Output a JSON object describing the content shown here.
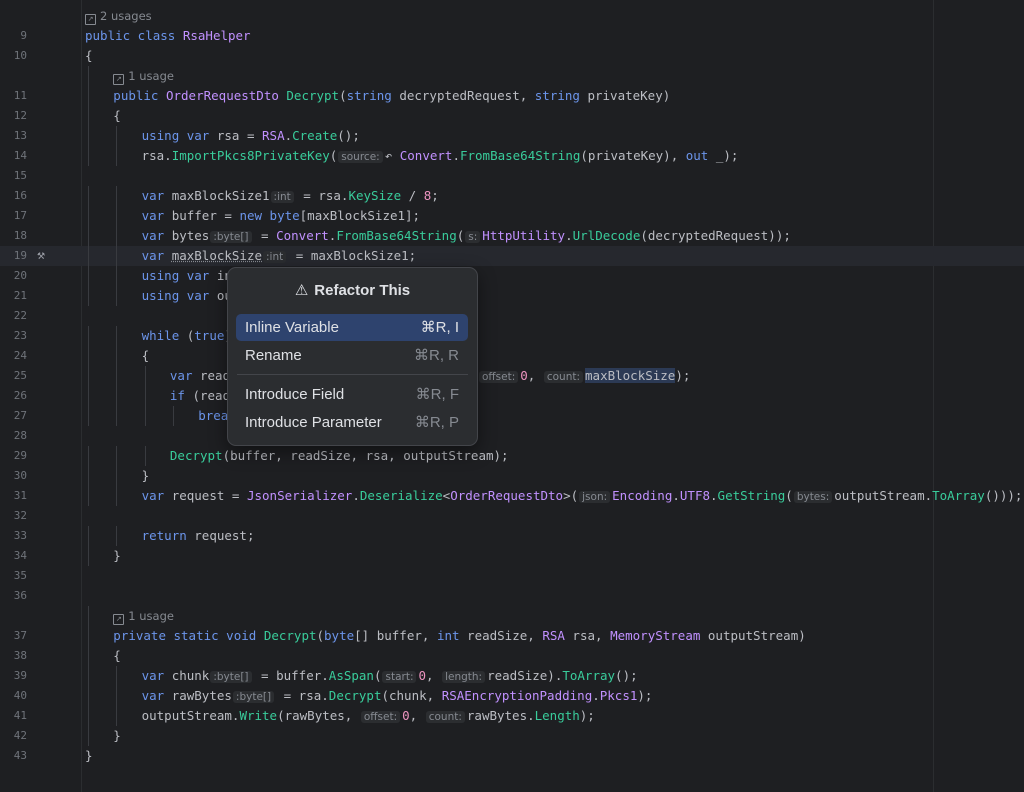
{
  "editor": {
    "lines": [
      {
        "ln": "",
        "tokens": [
          [
            "usage",
            "2 usages"
          ]
        ]
      },
      {
        "ln": "9",
        "tokens": [
          [
            "kw",
            "public class "
          ],
          [
            "ty",
            "RsaHelper"
          ]
        ]
      },
      {
        "ln": "10",
        "tokens": [
          [
            "sy",
            "{"
          ]
        ]
      },
      {
        "ln": "",
        "indent": 1,
        "tokens": [
          [
            "usage",
            "1 usage"
          ]
        ]
      },
      {
        "ln": "11",
        "indent": 1,
        "tokens": [
          [
            "kw",
            "public "
          ],
          [
            "ty",
            "OrderRequestDto "
          ],
          [
            "fn",
            "Decrypt"
          ],
          [
            "sy",
            "("
          ],
          [
            "kw",
            "string "
          ],
          [
            "sy",
            "decryptedRequest, "
          ],
          [
            "kw",
            "string "
          ],
          [
            "sy",
            "privateKey)"
          ]
        ]
      },
      {
        "ln": "12",
        "indent": 1,
        "tokens": [
          [
            "sy",
            "{"
          ]
        ]
      },
      {
        "ln": "13",
        "indent": 2,
        "tokens": [
          [
            "kw",
            "using var "
          ],
          [
            "sy",
            "rsa = "
          ],
          [
            "ty",
            "RSA"
          ],
          [
            "sy",
            "."
          ],
          [
            "fn",
            "Create"
          ],
          [
            "sy",
            "();"
          ]
        ]
      },
      {
        "ln": "14",
        "indent": 2,
        "tokens": [
          [
            "sy",
            "rsa."
          ],
          [
            "fn",
            "ImportPkcs8PrivateKey"
          ],
          [
            "sy",
            "("
          ],
          [
            "hint",
            "source:"
          ],
          [
            "sy",
            "↶ "
          ],
          [
            "ty",
            "Convert"
          ],
          [
            "sy",
            "."
          ],
          [
            "fn",
            "FromBase64String"
          ],
          [
            "sy",
            "(privateKey), "
          ],
          [
            "kw",
            "out "
          ],
          [
            "sy",
            "_);"
          ]
        ]
      },
      {
        "ln": "15",
        "tokens": []
      },
      {
        "ln": "16",
        "indent": 2,
        "tokens": [
          [
            "kw",
            "var "
          ],
          [
            "sy",
            "maxBlockSize1"
          ],
          [
            "hint",
            ":int"
          ],
          [
            "sy",
            " = rsa."
          ],
          [
            "fn",
            "KeySize"
          ],
          [
            "sy",
            " / "
          ],
          [
            "num",
            "8"
          ],
          [
            "sy",
            ";"
          ]
        ]
      },
      {
        "ln": "17",
        "indent": 2,
        "tokens": [
          [
            "kw",
            "var "
          ],
          [
            "sy",
            "buffer = "
          ],
          [
            "kw",
            "new byte"
          ],
          [
            "sy",
            "[maxBlockSize1];"
          ]
        ]
      },
      {
        "ln": "18",
        "indent": 2,
        "tokens": [
          [
            "kw",
            "var "
          ],
          [
            "sy",
            "bytes"
          ],
          [
            "hint",
            ":byte[]"
          ],
          [
            "sy",
            " = "
          ],
          [
            "ty",
            "Convert"
          ],
          [
            "sy",
            "."
          ],
          [
            "fn",
            "FromBase64String"
          ],
          [
            "sy",
            "("
          ],
          [
            "hint",
            "s:"
          ],
          [
            "ty",
            "HttpUtility"
          ],
          [
            "sy",
            "."
          ],
          [
            "fn",
            "UrlDecode"
          ],
          [
            "sy",
            "(decryptedRequest));"
          ]
        ]
      },
      {
        "ln": "19",
        "indent": 2,
        "gutterIcon": true,
        "caret": true,
        "tokens": [
          [
            "kw",
            "var "
          ],
          [
            "underline",
            "maxBlockSize"
          ],
          [
            "hint",
            ":int"
          ],
          [
            "sy",
            " = maxBlockSize1;"
          ]
        ]
      },
      {
        "ln": "20",
        "indent": 2,
        "tokens": [
          [
            "kw",
            "using var "
          ],
          [
            "sy",
            "in"
          ]
        ]
      },
      {
        "ln": "21",
        "indent": 2,
        "tokens": [
          [
            "kw",
            "using var "
          ],
          [
            "sy",
            "ou"
          ]
        ]
      },
      {
        "ln": "22",
        "tokens": []
      },
      {
        "ln": "23",
        "indent": 2,
        "tokens": [
          [
            "kw",
            "while "
          ],
          [
            "sy",
            "("
          ],
          [
            "kw",
            "true"
          ],
          [
            "sy",
            ")"
          ]
        ]
      },
      {
        "ln": "24",
        "indent": 2,
        "tokens": [
          [
            "sy",
            "{"
          ]
        ]
      },
      {
        "ln": "25",
        "indent": 3,
        "tokens": [
          [
            "kw",
            "var "
          ],
          [
            "sy",
            "read"
          ]
        ]
      },
      {
        "ln": "26",
        "indent": 3,
        "tokens": [
          [
            "kw",
            "if "
          ],
          [
            "sy",
            "(read"
          ]
        ]
      },
      {
        "ln": "27",
        "indent": 4,
        "tokens": [
          [
            "kw",
            "brea"
          ]
        ]
      },
      {
        "ln": "28",
        "tokens": []
      },
      {
        "ln": "29",
        "indent": 3,
        "tokens": [
          [
            "fn",
            "Decrypt"
          ],
          [
            "sy",
            "(buffer, readSize, rsa, outputStream);"
          ]
        ]
      },
      {
        "ln": "30",
        "indent": 2,
        "tokens": [
          [
            "sy",
            "}"
          ]
        ]
      },
      {
        "ln": "31",
        "indent": 2,
        "tokens": [
          [
            "kw",
            "var "
          ],
          [
            "sy",
            "request = "
          ],
          [
            "ty",
            "JsonSerializer"
          ],
          [
            "sy",
            "."
          ],
          [
            "fn",
            "Deserialize"
          ],
          [
            "sy",
            "<"
          ],
          [
            "ty",
            "OrderRequestDto"
          ],
          [
            "sy",
            ">("
          ],
          [
            "hint",
            "json:"
          ],
          [
            "ty",
            "Encoding"
          ],
          [
            "sy",
            "."
          ],
          [
            "ty",
            "UTF8"
          ],
          [
            "sy",
            "."
          ],
          [
            "fn",
            "GetString"
          ],
          [
            "sy",
            "("
          ],
          [
            "hint",
            "bytes:"
          ],
          [
            "sy",
            "outputStream."
          ],
          [
            "fn",
            "ToArray"
          ],
          [
            "sy",
            "()));"
          ]
        ]
      },
      {
        "ln": "32",
        "tokens": []
      },
      {
        "ln": "33",
        "indent": 2,
        "tokens": [
          [
            "kw",
            "return "
          ],
          [
            "sy",
            "request;"
          ]
        ]
      },
      {
        "ln": "34",
        "indent": 1,
        "tokens": [
          [
            "sy",
            "}"
          ]
        ]
      },
      {
        "ln": "35",
        "tokens": []
      },
      {
        "ln": "36",
        "tokens": []
      },
      {
        "ln": "",
        "indent": 1,
        "tokens": [
          [
            "usage",
            "1 usage"
          ]
        ]
      },
      {
        "ln": "37",
        "indent": 1,
        "tokens": [
          [
            "kw",
            "private static void "
          ],
          [
            "fn",
            "Decrypt"
          ],
          [
            "sy",
            "("
          ],
          [
            "kw",
            "byte"
          ],
          [
            "sy",
            "[] buffer, "
          ],
          [
            "kw",
            "int "
          ],
          [
            "sy",
            "readSize, "
          ],
          [
            "ty",
            "RSA "
          ],
          [
            "sy",
            "rsa, "
          ],
          [
            "ty",
            "MemoryStream "
          ],
          [
            "sy",
            "outputStream)"
          ]
        ]
      },
      {
        "ln": "38",
        "indent": 1,
        "tokens": [
          [
            "sy",
            "{"
          ]
        ]
      },
      {
        "ln": "39",
        "indent": 2,
        "tokens": [
          [
            "kw",
            "var "
          ],
          [
            "sy",
            "chunk"
          ],
          [
            "hint",
            ":byte[]"
          ],
          [
            "sy",
            " = buffer."
          ],
          [
            "fn",
            "AsSpan"
          ],
          [
            "sy",
            "("
          ],
          [
            "hint",
            "start:"
          ],
          [
            "num",
            "0"
          ],
          [
            "sy",
            ", "
          ],
          [
            "hint",
            "length:"
          ],
          [
            "sy",
            "readSize)."
          ],
          [
            "fn",
            "ToArray"
          ],
          [
            "sy",
            "();"
          ]
        ]
      },
      {
        "ln": "40",
        "indent": 2,
        "tokens": [
          [
            "kw",
            "var "
          ],
          [
            "sy",
            "rawBytes"
          ],
          [
            "hint",
            ":byte[]"
          ],
          [
            "sy",
            " = rsa."
          ],
          [
            "fn",
            "Decrypt"
          ],
          [
            "sy",
            "(chunk, "
          ],
          [
            "ty",
            "RSAEncryptionPadding"
          ],
          [
            "sy",
            "."
          ],
          [
            "ty",
            "Pkcs1"
          ],
          [
            "sy",
            ");"
          ]
        ]
      },
      {
        "ln": "41",
        "indent": 2,
        "tokens": [
          [
            "sy",
            "outputStream."
          ],
          [
            "fn",
            "Write"
          ],
          [
            "sy",
            "(rawBytes, "
          ],
          [
            "hint",
            "offset:"
          ],
          [
            "num",
            "0"
          ],
          [
            "sy",
            ", "
          ],
          [
            "hint",
            "count:"
          ],
          [
            "sy",
            "rawBytes."
          ],
          [
            "fn",
            "Length"
          ],
          [
            "sy",
            ");"
          ]
        ]
      },
      {
        "ln": "42",
        "indent": 1,
        "tokens": [
          [
            "sy",
            "}"
          ]
        ]
      },
      {
        "ln": "43",
        "tokens": [
          [
            "sy",
            "}"
          ]
        ]
      }
    ],
    "line25_tail": {
      "offset_hint": "offset:",
      "offset_val": "0",
      "sep": ", ",
      "count_hint": "count:",
      "count_val": "maxBlockSize",
      "end": ");"
    }
  },
  "popup": {
    "title": "Refactor This",
    "items": [
      {
        "label": "Inline Variable",
        "shortcut": "⌘R, I"
      },
      {
        "label": "Rename",
        "shortcut": "⌘R, R"
      },
      {
        "label": "Introduce Field",
        "shortcut": "⌘R, F"
      },
      {
        "label": "Introduce Parameter",
        "shortcut": "⌘R, P"
      }
    ]
  }
}
